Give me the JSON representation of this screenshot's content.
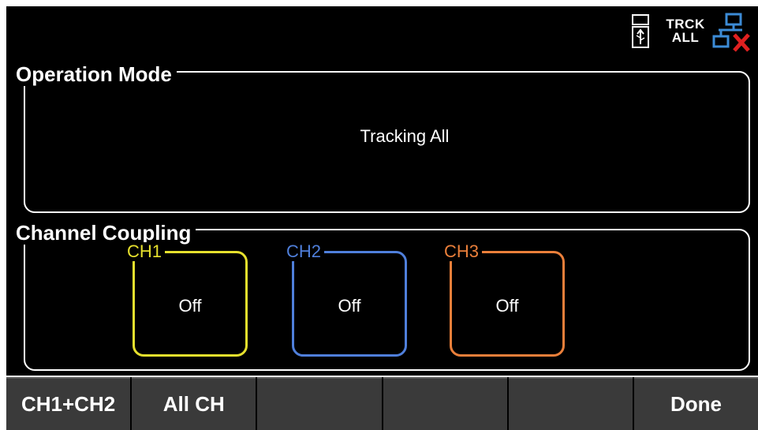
{
  "status": {
    "usb_icon": "usb-icon",
    "mode_line1": "TRCK",
    "mode_line2": "ALL",
    "network_icon": "network-disconnected-icon"
  },
  "operation_mode": {
    "title": "Operation Mode",
    "value": "Tracking All"
  },
  "channel_coupling": {
    "title": "Channel Coupling",
    "channels": [
      {
        "label": "CH1",
        "value": "Off",
        "color": "#e6e02d"
      },
      {
        "label": "CH2",
        "value": "Off",
        "color": "#4f7fdb"
      },
      {
        "label": "CH3",
        "value": "Off",
        "color": "#ea7f3a"
      }
    ]
  },
  "softkeys": [
    "CH1+CH2",
    "All CH",
    "",
    "",
    "",
    "Done"
  ]
}
